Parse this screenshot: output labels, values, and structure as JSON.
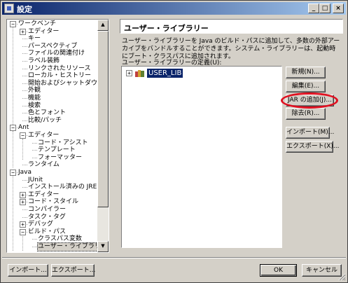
{
  "window": {
    "title": "設定",
    "controls": {
      "minimize": "_",
      "maximize": "□",
      "close": "×"
    }
  },
  "tree": {
    "nodes": [
      {
        "label": "ワークベンチ",
        "expander": "−"
      },
      {
        "label": "エディター",
        "expander": "+"
      },
      {
        "label": "キー"
      },
      {
        "label": "パースペクティブ"
      },
      {
        "label": "ファイルの関連付け"
      },
      {
        "label": "ラベル装飾"
      },
      {
        "label": "リンクされたリソース"
      },
      {
        "label": "ローカル・ヒストリー"
      },
      {
        "label": "開始およびシャットダウン"
      },
      {
        "label": "外観"
      },
      {
        "label": "機能"
      },
      {
        "label": "検索"
      },
      {
        "label": "色とフォント"
      },
      {
        "label": "比較/パッチ"
      },
      {
        "label": "Ant",
        "expander": "−"
      },
      {
        "label": "エディター",
        "expander": "−"
      },
      {
        "label": "コード・アシスト"
      },
      {
        "label": "テンプレート"
      },
      {
        "label": "フォーマッター"
      },
      {
        "label": "ランタイム"
      },
      {
        "label": "Java",
        "expander": "−"
      },
      {
        "label": "JUnit"
      },
      {
        "label": "インストール済みの JRE"
      },
      {
        "label": "エディター",
        "expander": "+"
      },
      {
        "label": "コード・スタイル",
        "expander": "+"
      },
      {
        "label": "コンパイラー"
      },
      {
        "label": "タスク・タグ"
      },
      {
        "label": "デバッグ",
        "expander": "+"
      },
      {
        "label": "ビルド・パス",
        "expander": "−"
      },
      {
        "label": "クラスパス変数"
      },
      {
        "label": "ユーザー・ライブラリー"
      }
    ],
    "scroll": {
      "up": "▲",
      "down": "▼"
    }
  },
  "main": {
    "heading": "ユーザー・ライブラリー",
    "description": "ユーザー・ライブラリーを Java のビルド・パスに追加して、多数の外部アーカイブをバンドルすることができます。システム・ライブラリーは、起動時にブート・クラスパスに追加されます。",
    "list_label": "ユーザー・ライブラリーの定義(U):",
    "libraries": [
      {
        "name": "USER_LIB",
        "expander": "+"
      }
    ],
    "buttons": {
      "new": "新規(N)...",
      "edit": "編集(E)...",
      "add_jar": "JAR の追加(J)...",
      "remove": "除去(R)...",
      "import": "インポート(M)...",
      "export": "エクスポート(X)..."
    }
  },
  "footer": {
    "import": "インポート...",
    "export": "エクスポート...",
    "ok": "OK",
    "cancel": "キャンセル"
  },
  "colors": {
    "title_gradient_start": "#0a246a",
    "title_gradient_end": "#a6caf0",
    "selection": "#0a246a",
    "highlight_ellipse": "#e01020",
    "face": "#d4d0c8"
  }
}
